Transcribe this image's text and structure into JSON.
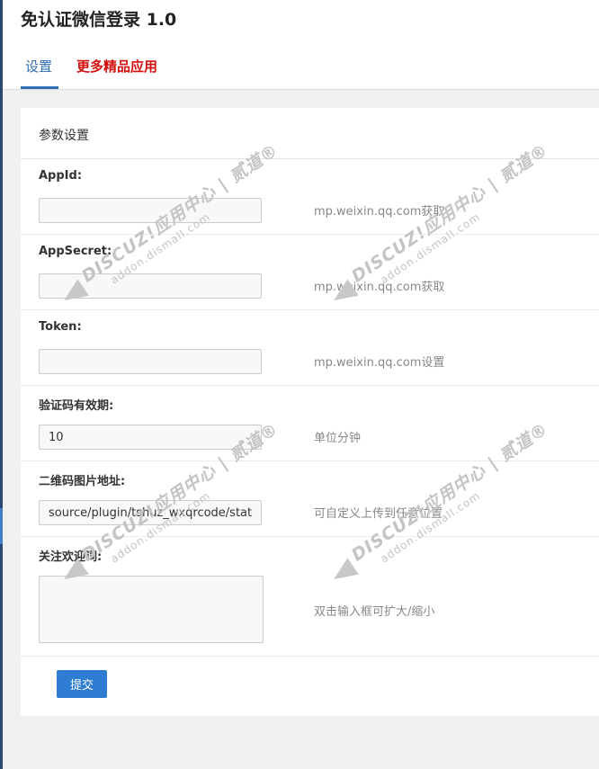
{
  "app": {
    "title": "免认证微信登录 1.0"
  },
  "tabs": [
    {
      "label": "设置"
    },
    {
      "label": "更多精品应用"
    }
  ],
  "panel": {
    "title": "参数设置"
  },
  "fields": [
    {
      "label": "AppId:",
      "value": "",
      "help": "mp.weixin.qq.com获取"
    },
    {
      "label": "AppSecret:",
      "value": "",
      "help": "mp.weixin.qq.com获取"
    },
    {
      "label": "Token:",
      "value": "",
      "help": "mp.weixin.qq.com设置"
    },
    {
      "label": "验证码有效期:",
      "value": "10",
      "help": "单位分钟"
    },
    {
      "label": "二维码图片地址:",
      "value": "source/plugin/tshuz_wxqrcode/static/",
      "help": "可自定义上传到任意位置"
    },
    {
      "label": "关注欢迎词:",
      "value": "",
      "help": "双击输入框可扩大/缩小"
    }
  ],
  "submit": {
    "label": "提交"
  },
  "watermark": {
    "line1": "DISCUZ!应用中心 | 贰道®",
    "line2": "addon.dismall.com"
  },
  "colors": {
    "accent": "#2f6fb3",
    "highlight": "#d40f0f",
    "button": "#2e7dd2",
    "sidebar": "#2a4a72"
  }
}
